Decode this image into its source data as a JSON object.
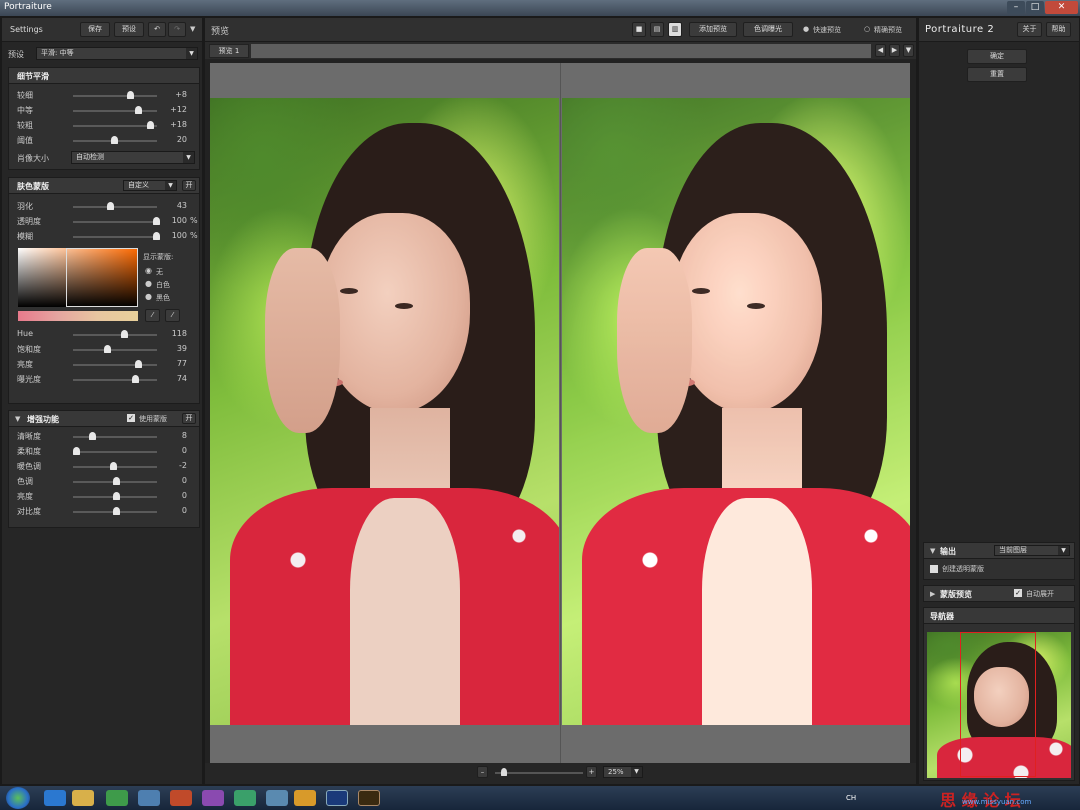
{
  "window": {
    "title": "Portraiture",
    "min_icon": "minimize-icon",
    "max_icon": "maximize-icon",
    "close_icon": "close-icon"
  },
  "left_panel": {
    "settings_label": "Settings",
    "save_label": "保存",
    "reset_label": "预设",
    "preset_label": "预设",
    "preset_value": "平滑: 中等",
    "detail": {
      "title": "细节平滑",
      "sliders": [
        {
          "name": "较细",
          "value": "+8",
          "pos": 0.68
        },
        {
          "name": "中等",
          "value": "+12",
          "pos": 0.78
        },
        {
          "name": "较粗",
          "value": "+18",
          "pos": 0.92
        },
        {
          "name": "阈值",
          "value": "20",
          "pos": 0.48
        }
      ],
      "portrait_size_label": "肖像大小",
      "portrait_size_value": "自动检测"
    },
    "skin": {
      "title": "肤色蒙版",
      "mode_value": "自定义",
      "toggle_label": "开",
      "sliders": [
        {
          "name": "羽化",
          "value": "43",
          "unit": "",
          "pos": 0.43
        },
        {
          "name": "透明度",
          "value": "100",
          "unit": "%",
          "pos": 1.0
        },
        {
          "name": "模糊",
          "value": "100",
          "unit": "%",
          "pos": 1.0
        }
      ],
      "show_mask_label": "显示蒙版:",
      "radios": [
        "无",
        "白色",
        "黑色"
      ],
      "hue_sliders": [
        {
          "name": "Hue",
          "value": "118",
          "pos": 0.6
        },
        {
          "name": "饱和度",
          "value": "39",
          "pos": 0.39
        },
        {
          "name": "亮度",
          "value": "77",
          "pos": 0.77
        },
        {
          "name": "曝光度",
          "value": "74",
          "pos": 0.74
        }
      ]
    },
    "enhance": {
      "title": "增强功能",
      "use_mask_label": "使用蒙版",
      "toggle_label": "开",
      "sliders": [
        {
          "name": "清晰度",
          "value": "8",
          "pos": 0.2
        },
        {
          "name": "柔和度",
          "value": "0",
          "pos": 0.0
        },
        {
          "name": "暖色调",
          "value": "-2",
          "pos": 0.46
        },
        {
          "name": "色调",
          "value": "0",
          "pos": 0.5
        },
        {
          "name": "亮度",
          "value": "0",
          "pos": 0.5
        },
        {
          "name": "对比度",
          "value": "0",
          "pos": 0.5
        }
      ]
    }
  },
  "center": {
    "preview_label": "预览",
    "tab_label": "预览 1",
    "add_preview_label": "添加预览",
    "pick_color_label": "色调曝光",
    "fast_preview_label": "快速预览",
    "accurate_preview_label": "精确预览",
    "zoom_value": "25%"
  },
  "right_panel": {
    "brand_prefix": "Portraiture",
    "brand_version": "2",
    "about_label": "关于",
    "help_label": "帮助",
    "ok_label": "确定",
    "reset_label": "重置",
    "output_title": "输出",
    "output_value": "当前图层",
    "create_mask_label": "创建透明蒙版",
    "mask_preview_title": "蒙版预览",
    "auto_expand_label": "自动展开",
    "navigator_title": "导航器"
  },
  "taskbar": {
    "lang": "CH",
    "watermark": "思 缘 论 坛",
    "watermark_url": "www.missyuan.com"
  }
}
